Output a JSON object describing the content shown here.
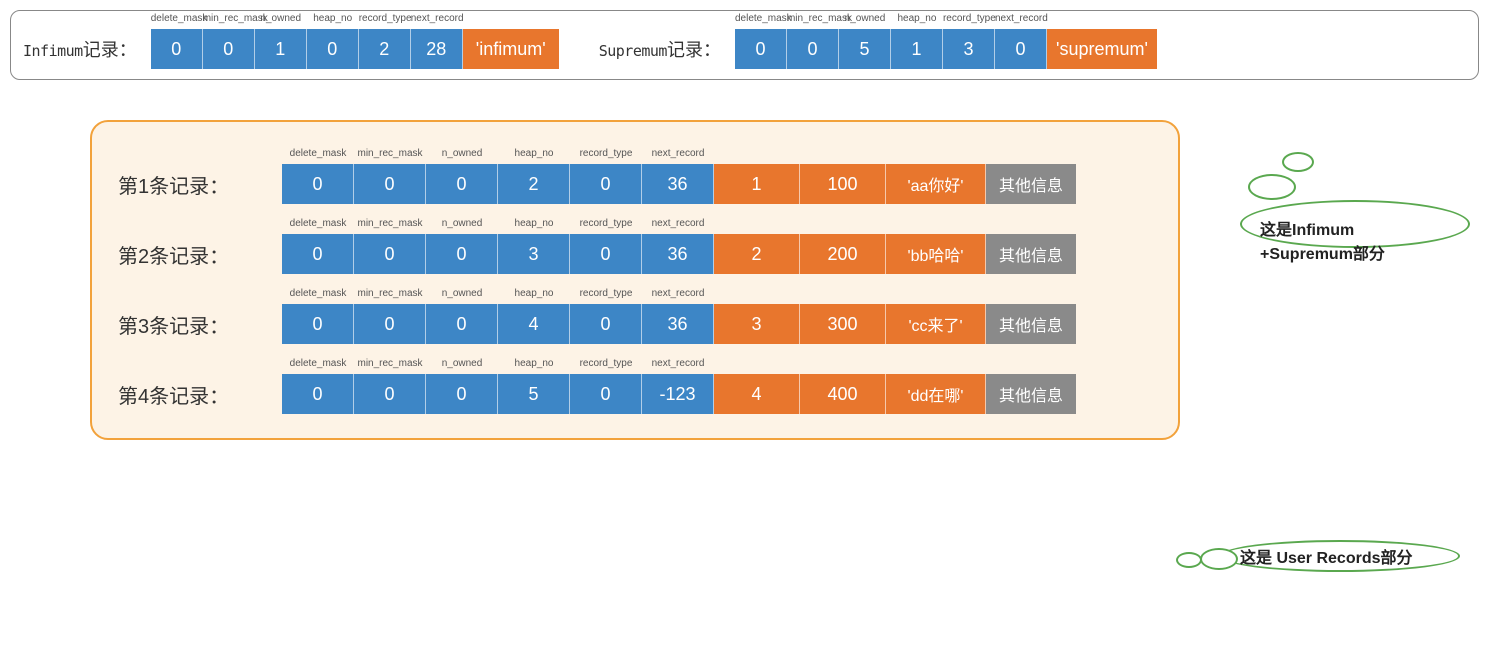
{
  "colors": {
    "blue": "#3d86c6",
    "orange": "#e8762d",
    "gray": "#8a8a8a",
    "userBoxBorder": "#f2a23c",
    "calloutBorder": "#5aa84f"
  },
  "headerFields": [
    "delete_mask",
    "min_rec_mask",
    "n_owned",
    "heap_no",
    "record_type",
    "next_record"
  ],
  "top": {
    "infimum": {
      "labelPrefix": "Infimum",
      "labelSuffix": "记录：",
      "header": [
        "0",
        "0",
        "1",
        "0",
        "2",
        "28"
      ],
      "body": "'infimum'"
    },
    "supremum": {
      "labelPrefix": "Supremum",
      "labelSuffix": "记录：",
      "header": [
        "0",
        "0",
        "5",
        "1",
        "3",
        "0"
      ],
      "body": "'supremum'"
    }
  },
  "userRecords": [
    {
      "label": "第1条记录：",
      "header": [
        "0",
        "0",
        "0",
        "2",
        "0",
        "36"
      ],
      "data": [
        "1",
        "100",
        "'aa你好'"
      ],
      "extra": "其他信息"
    },
    {
      "label": "第2条记录：",
      "header": [
        "0",
        "0",
        "0",
        "3",
        "0",
        "36"
      ],
      "data": [
        "2",
        "200",
        "'bb哈哈'"
      ],
      "extra": "其他信息"
    },
    {
      "label": "第3条记录：",
      "header": [
        "0",
        "0",
        "0",
        "4",
        "0",
        "36"
      ],
      "data": [
        "3",
        "300",
        "'cc来了'"
      ],
      "extra": "其他信息"
    },
    {
      "label": "第4条记录：",
      "header": [
        "0",
        "0",
        "0",
        "5",
        "0",
        "-123"
      ],
      "data": [
        "4",
        "400",
        "'dd在哪'"
      ],
      "extra": "其他信息"
    }
  ],
  "callouts": {
    "c1": "这是Infimum +Supremum部分",
    "c2": "这是 User Records部分"
  }
}
